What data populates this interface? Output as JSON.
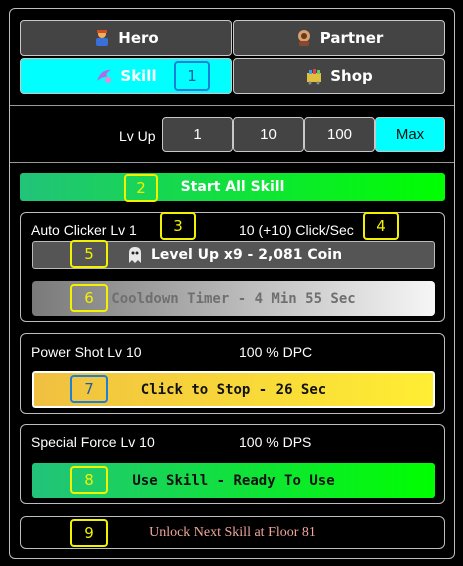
{
  "tabs": [
    {
      "label": "Hero",
      "icon": "hero-icon"
    },
    {
      "label": "Partner",
      "icon": "partner-icon"
    },
    {
      "label": "Skill",
      "icon": "skill-icon",
      "active": true
    },
    {
      "label": "Shop",
      "icon": "shop-icon"
    }
  ],
  "lvup": {
    "label": "Lv Up",
    "options": [
      "1",
      "10",
      "100",
      "Max"
    ],
    "selected": "Max"
  },
  "start_all": {
    "label": "Start All Skill"
  },
  "skills": [
    {
      "name": "Auto Clicker Lv 1",
      "stat": "10 (+10) Click/Sec",
      "level_up": "Level Up x9 - 2,081 Coin",
      "cooldown": "Cooldown Timer - 4 Min 55 Sec"
    },
    {
      "name": "Power Shot Lv 10",
      "stat": "100 % DPC",
      "action": "Click to Stop - 26 Sec"
    },
    {
      "name": "Special Force Lv 10",
      "stat": "100 % DPS",
      "action": "Use Skill - Ready To Use"
    }
  ],
  "unlock": {
    "label": "Unlock Next Skill at Floor 81"
  },
  "badges": [
    "1",
    "2",
    "3",
    "4",
    "5",
    "6",
    "7",
    "8",
    "9"
  ],
  "colors": {
    "active_tab": "#00ffff",
    "green_start": "#22c37a",
    "green_end": "#00ff00",
    "yellow": "#ffe333",
    "unlock_text": "#f0a69a",
    "badge": "#f2f200"
  }
}
